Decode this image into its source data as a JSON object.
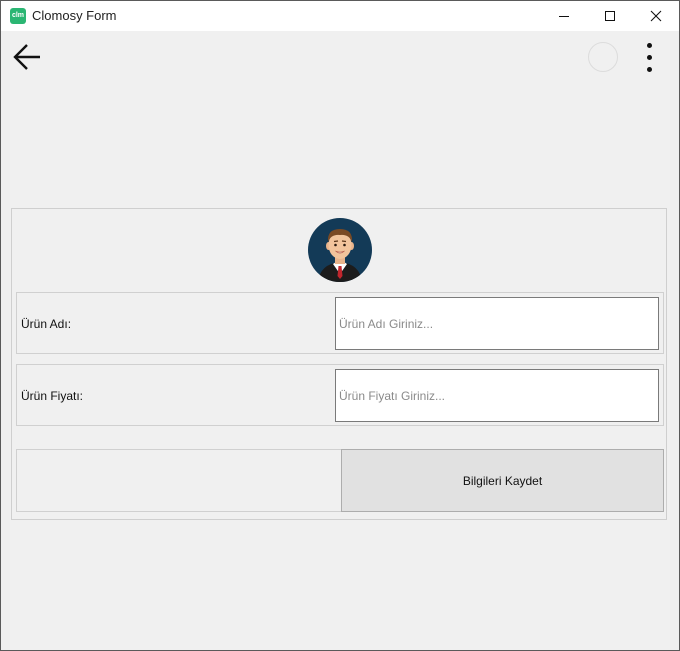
{
  "window": {
    "title": "Clomosy Form",
    "app_icon_text": "clm"
  },
  "toolbar": {
    "back_icon": "arrow-left-icon",
    "more_icon": "more-vertical-icon"
  },
  "form": {
    "avatar_icon": "user-avatar-icon",
    "product_name": {
      "label": "Ürün Adı:",
      "placeholder": "Ürün Adı Giriniz...",
      "value": ""
    },
    "product_price": {
      "label": "Ürün Fiyatı:",
      "placeholder": "Ürün Fiyatı Giriniz...",
      "value": ""
    },
    "save_label": "Bilgileri Kaydet"
  },
  "colors": {
    "background": "#f0f0f0",
    "app_icon": "#2bb673",
    "avatar_bg": "#133a57",
    "button_bg": "#e1e1e1"
  }
}
